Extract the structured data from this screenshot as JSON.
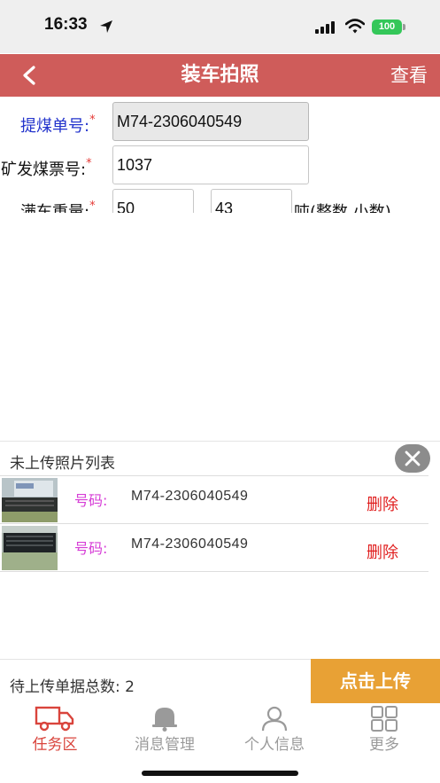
{
  "status_bar": {
    "time": "16:33",
    "battery": "100"
  },
  "header": {
    "title": "装车拍照",
    "right_action": "查看",
    "back_icon": "chevron-left-icon"
  },
  "form": {
    "coal_order": {
      "label": "提煤单号:",
      "required": "*",
      "value": "M74-2306040549"
    },
    "mine_ticket": {
      "label": "矿发煤票号:",
      "required": "*",
      "value": "1037"
    },
    "full_weight": {
      "label": "满车重量:",
      "required": "*",
      "integer_value": "50",
      "decimal_value": "43",
      "unit_hint": "吨(整数.小数)"
    }
  },
  "unuploaded_list": {
    "title": "未上传照片列表",
    "items": [
      {
        "code_label": "号码:",
        "code": "M74-2306040549",
        "delete_label": "删除"
      },
      {
        "code_label": "号码:",
        "code": "M74-2306040549",
        "delete_label": "删除"
      }
    ]
  },
  "footer": {
    "pending_label": "待上传单据总数: 2",
    "upload_button": "点击上传"
  },
  "tabs": [
    {
      "label": "任务区",
      "icon": "truck-icon",
      "active": true
    },
    {
      "label": "消息管理",
      "icon": "bell-icon",
      "active": false
    },
    {
      "label": "个人信息",
      "icon": "person-icon",
      "active": false
    },
    {
      "label": "更多",
      "icon": "grid-icon",
      "active": false
    }
  ],
  "colors": {
    "header": "#cf5c5a",
    "upload_button": "#e8a135",
    "active_tab": "#d9443c",
    "delete": "#e02020",
    "code_label": "#d63cd6",
    "order_label": "#2233cc"
  }
}
